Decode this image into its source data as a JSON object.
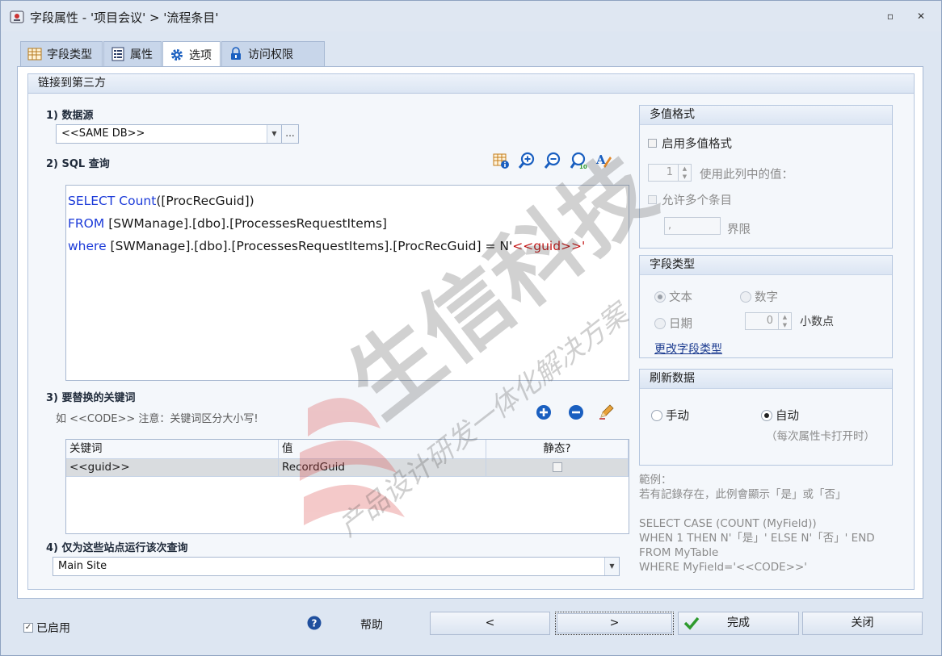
{
  "window": {
    "title": "字段属性 - '项目会议' > '流程条目'",
    "restore_glyph": "▫",
    "close_glyph": "✕"
  },
  "tabs": [
    {
      "label": "字段类型",
      "icon": "table-grid-icon"
    },
    {
      "label": "属性",
      "icon": "properties-list-icon"
    },
    {
      "label": "选项",
      "icon": "gear-icon",
      "active": true
    },
    {
      "label": "访问权限",
      "icon": "lock-icon"
    }
  ],
  "group": {
    "title": "链接到第三方"
  },
  "datasource": {
    "label": "1) 数据源",
    "value": "<<SAME DB>>",
    "ellipsis": "..."
  },
  "sql": {
    "label": "2) SQL 查询",
    "line1": {
      "kw": "SELECT ",
      "fn": "Count",
      "rest": "([ProcRecGuid])"
    },
    "line2": {
      "kw": "FROM ",
      "rest": "[SWManage].[dbo].[ProcessesRequestItems]"
    },
    "line3": {
      "kw": "where ",
      "rest": "[SWManage].[dbo].[ProcessesRequestItems].[ProcRecGuid] = N'",
      "str": "<<guid>>'"
    },
    "toolbar": [
      "table-info-icon",
      "zoom-in-icon",
      "zoom-out-icon",
      "zoom-100-icon",
      "spellcheck-icon"
    ]
  },
  "keywords": {
    "label": "3) 要替换的关键词",
    "hint": "如 <<CODE>>   注意：关键词区分大小写!",
    "columns": [
      "关键词",
      "值",
      "静态?"
    ],
    "rows": [
      {
        "keyword": "<<guid>>",
        "value": "RecordGuid",
        "static": false
      }
    ]
  },
  "sites": {
    "label": "4) 仅为这些站点运行该次查询",
    "value": "Main Site"
  },
  "multivalue": {
    "title": "多值格式",
    "enable_label": "启用多值格式",
    "column_value": "1",
    "column_label": "使用此列中的值：",
    "allow_multiple_label": "允许多个条目",
    "delimiter_value": ",",
    "delimiter_label": "界限"
  },
  "field_type": {
    "title": "字段类型",
    "text_label": "文本",
    "number_label": "数字",
    "date_label": "日期",
    "decimals_value": "0",
    "decimals_label": "小数点",
    "change_link": "更改字段类型"
  },
  "refresh": {
    "title": "刷新数据",
    "manual_label": "手动",
    "auto_label": "自动",
    "auto_note": "（每次属性卡打开时）"
  },
  "example": {
    "text": "範例：\n若有記錄存在，此例會顯示「是」或「否」\n\nSELECT CASE (COUNT (MyField))\nWHEN 1 THEN N'「是」' ELSE N'「否」' END\nFROM MyTable\nWHERE MyField='<<CODE>>'"
  },
  "footer": {
    "enabled_label": "已启用",
    "help_label": "帮助",
    "prev_label": "<",
    "next_label": ">",
    "finish_label": "完成",
    "close_label": "关闭"
  },
  "watermark": {
    "main": "生信科技",
    "sub": "产品设计研发一体化解决方案"
  },
  "colors": {
    "sql_keyword": "#1c3bd9",
    "sql_string": "#c41818",
    "finish_check": "#2e9a2e",
    "accent_blue": "#1a5fc0"
  }
}
